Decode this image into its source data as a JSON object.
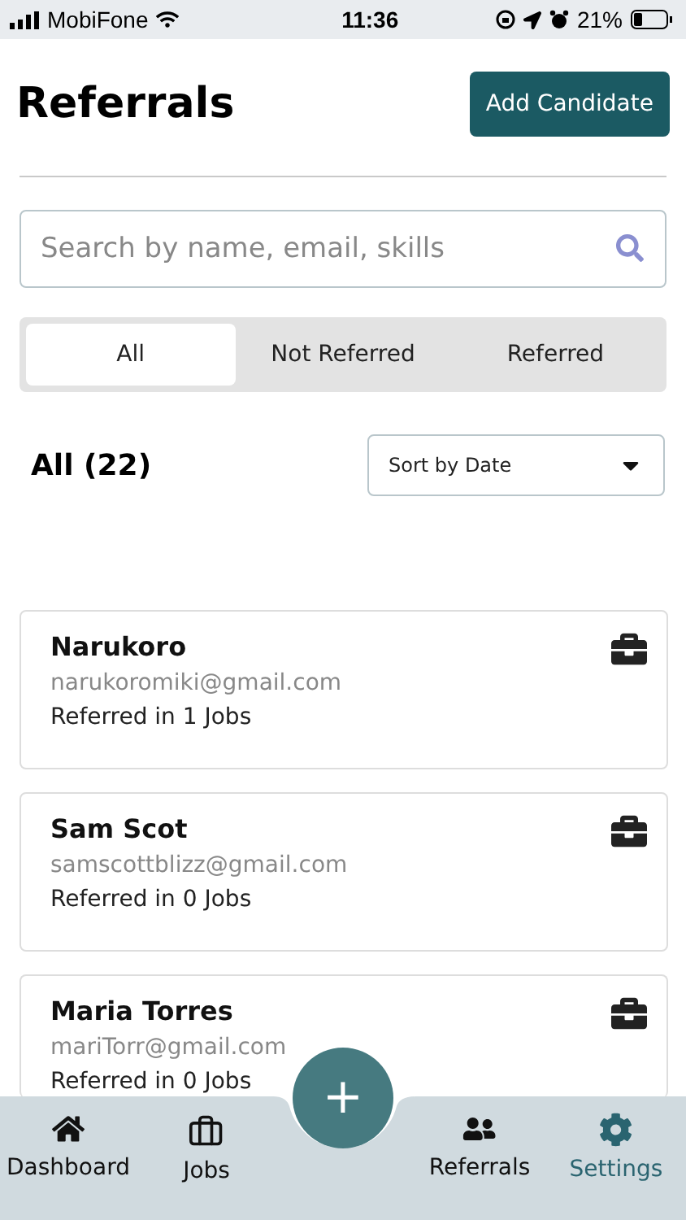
{
  "status_bar": {
    "carrier": "MobiFone",
    "time": "11:36",
    "battery": "21%"
  },
  "header": {
    "title": "Referrals",
    "action": "Add Candidate"
  },
  "search": {
    "placeholder": "Search by name, email, skills"
  },
  "tabs": [
    {
      "label": "All",
      "selected": true
    },
    {
      "label": "Not Referred",
      "selected": false
    },
    {
      "label": "Referred",
      "selected": false
    }
  ],
  "list_header": {
    "count_label": "All (22)",
    "sort": "Sort by Date"
  },
  "candidates": [
    {
      "name": "Narukoro",
      "email": "narukoromiki@gmail.com",
      "referred": "Referred in 1 Jobs"
    },
    {
      "name": "Sam Scot",
      "email": "samscottblizz@gmail.com",
      "referred": "Referred in 0 Jobs"
    },
    {
      "name": "Maria Torres",
      "email": "mariTorr@gmail.com",
      "referred": "Referred in 0 Jobs"
    }
  ],
  "fab": {
    "label": "+"
  },
  "nav": [
    {
      "label": "Dashboard",
      "selected": false
    },
    {
      "label": "Jobs",
      "selected": false
    },
    {
      "label": "Referrals",
      "selected": false
    },
    {
      "label": "Settings",
      "selected": true
    }
  ]
}
